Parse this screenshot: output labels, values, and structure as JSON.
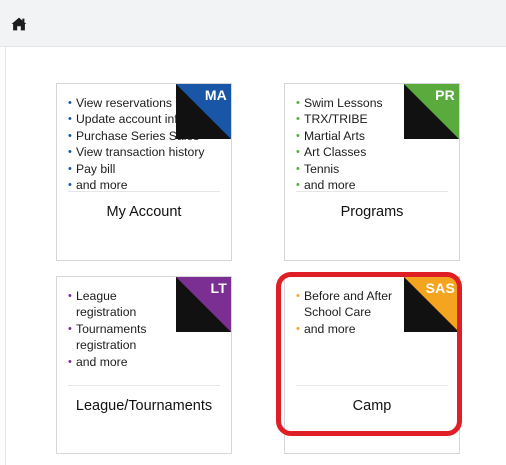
{
  "header": {
    "home_icon": "home-icon"
  },
  "colors": {
    "ma": "#1a56a8",
    "pr": "#5aaa3e",
    "lt": "#7b2f92",
    "sas": "#f4a41f",
    "highlight": "#e01e26"
  },
  "cards": {
    "ma": {
      "badge": "MA",
      "title": "My Account",
      "items": [
        "View reservations",
        "Update account info",
        "Purchase Series Sales",
        "View transaction history",
        "Pay bill",
        "and more"
      ]
    },
    "pr": {
      "badge": "PR",
      "title": "Programs",
      "items": [
        "Swim Lessons",
        "TRX/TRIBE",
        "Martial Arts",
        "Art Classes",
        "Tennis",
        "and more"
      ]
    },
    "lt": {
      "badge": "LT",
      "title": "League/Tournaments",
      "items": [
        "League registration",
        "Tournaments registration",
        "and more"
      ]
    },
    "sas": {
      "badge": "SAS",
      "title": "Camp",
      "items": [
        "Before and After School Care",
        "and more"
      ]
    }
  }
}
